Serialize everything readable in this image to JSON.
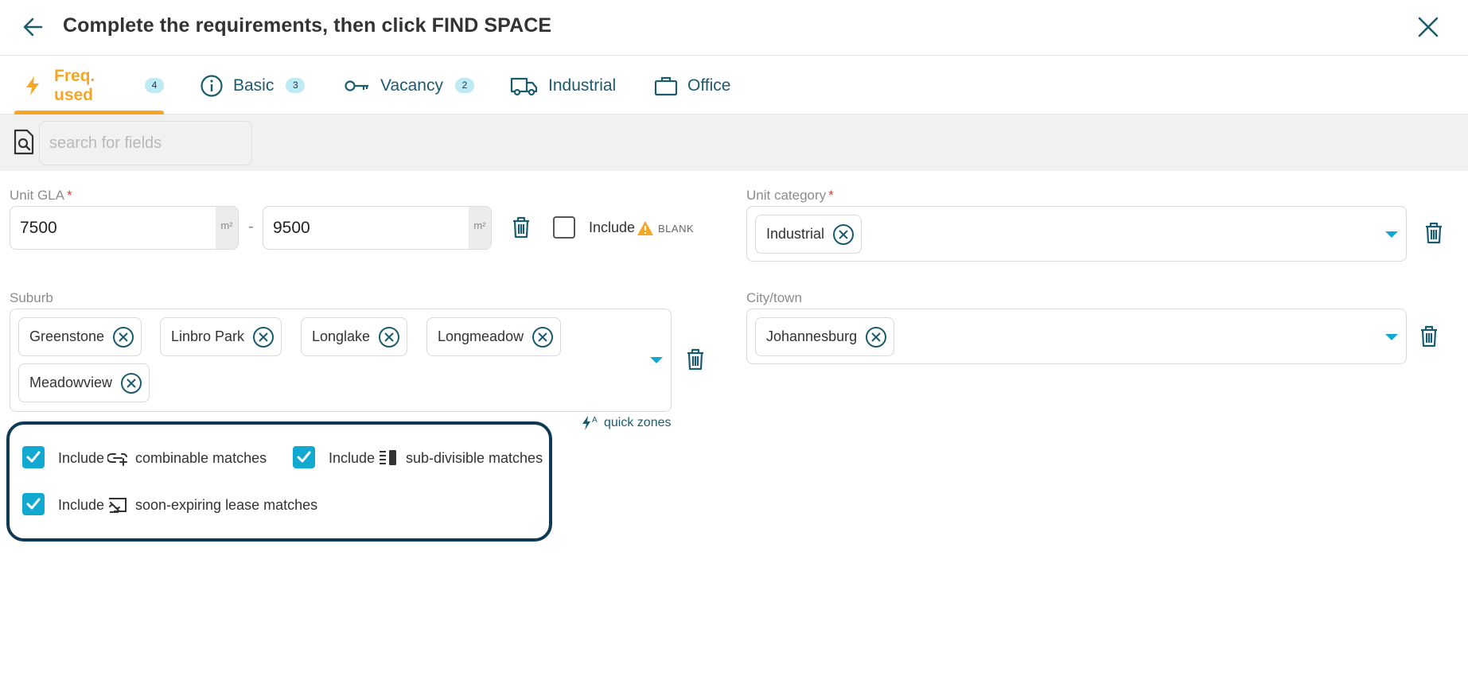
{
  "header": {
    "title": "Complete the requirements, then click FIND SPACE"
  },
  "tabs": [
    {
      "label": "Freq. used",
      "badge": "4",
      "icon": "lightning-icon",
      "active": true
    },
    {
      "label": "Basic",
      "badge": "3",
      "icon": "info-icon",
      "active": false
    },
    {
      "label": "Vacancy",
      "badge": "2",
      "icon": "key-icon",
      "active": false
    },
    {
      "label": "Industrial",
      "badge": "",
      "icon": "truck-icon",
      "active": false
    },
    {
      "label": "Office",
      "badge": "",
      "icon": "briefcase-icon",
      "active": false
    }
  ],
  "search": {
    "placeholder": "search for fields",
    "value": ""
  },
  "unit_gla": {
    "label": "Unit GLA",
    "required_mark": "*",
    "min": "7500",
    "max": "9500",
    "unit": "m²",
    "separator": "-",
    "include_label": "Include",
    "blank_label": "BLANK",
    "include_blank_checked": false
  },
  "unit_category": {
    "label": "Unit category",
    "required_mark": "*",
    "chips": [
      "Industrial"
    ]
  },
  "suburb": {
    "label": "Suburb",
    "chips": [
      "Greenstone",
      "Linbro Park",
      "Longlake",
      "Longmeadow",
      "Meadowview"
    ],
    "quick_zones_label": "quick zones"
  },
  "city_town": {
    "label": "City/town",
    "chips": [
      "Johannesburg"
    ]
  },
  "options": {
    "combinable": {
      "include": "Include",
      "text": "combinable matches",
      "checked": true
    },
    "subdivisible": {
      "include": "Include",
      "text": "sub-divisible matches",
      "checked": true
    },
    "soon_expiring": {
      "include": "Include",
      "text": "soon-expiring lease matches",
      "checked": true
    }
  },
  "colors": {
    "accent_orange": "#f5a623",
    "teal_text": "#1b5b6e",
    "checkbox_blue": "#11a9cf",
    "badge_bg": "#bdeaf3",
    "panel_border": "#0e3a56",
    "required_red": "#e23b3b"
  }
}
